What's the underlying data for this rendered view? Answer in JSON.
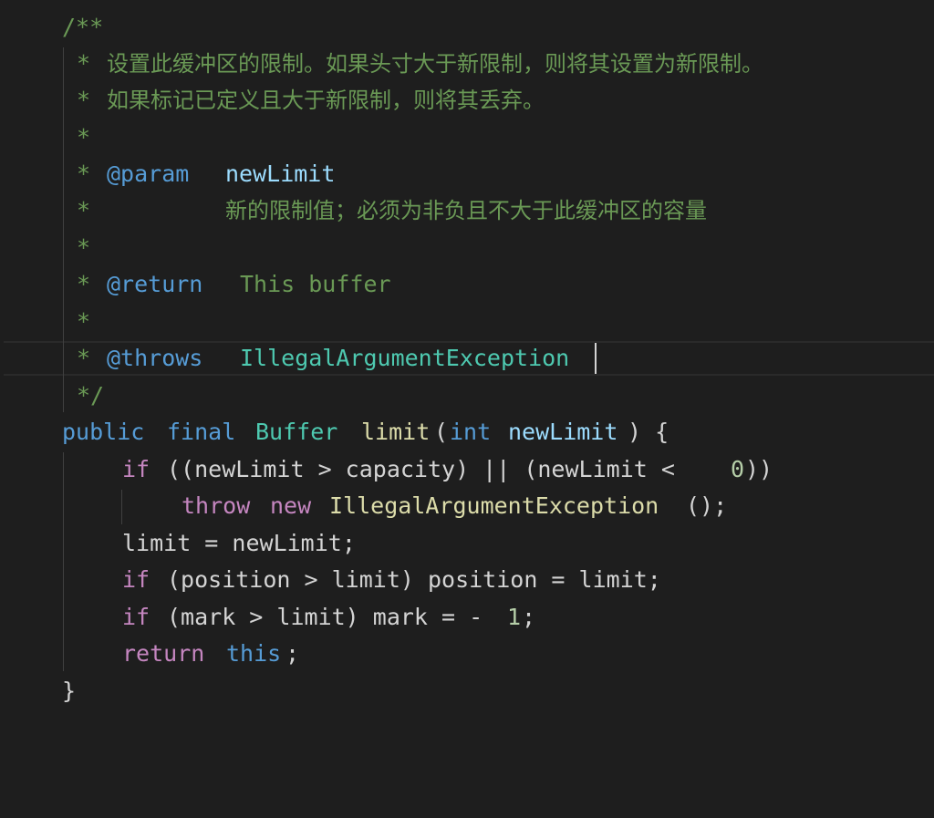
{
  "colors": {
    "background": "#1e1e1e",
    "comment": "#6a9955",
    "doc_tag": "#569cd6",
    "param_name": "#9cdcfe",
    "type": "#4ec9b0",
    "keyword": "#569cd6",
    "control_keyword": "#c586c0",
    "function": "#dcdcaa",
    "number": "#b5cea8",
    "plain": "#d4d4d4"
  },
  "code": {
    "javadoc": {
      "open": "/**",
      "star": "*",
      "close": "*/",
      "desc_line_1": "设置此缓冲区的限制。如果头寸大于新限制，则将其设置为新限制。",
      "desc_line_2": "如果标记已定义且大于新限制，则将其丢弃。",
      "param_tag": "@param",
      "param_name": "newLimit",
      "param_desc": "新的限制值；必须为非负且不大于此缓冲区的容量",
      "return_tag": "@return",
      "return_desc": "This buffer",
      "throws_tag": "@throws",
      "throws_type": "IllegalArgumentException"
    },
    "signature": {
      "kw_public": "public",
      "kw_final": "final",
      "return_type": "Buffer",
      "method_name": "limit",
      "open_paren": "(",
      "param_type": "int",
      "param_name": "newLimit",
      "close_brace_open": ") {"
    },
    "if1": {
      "kw_if": "if",
      "cond_part_1": "((newLimit > capacity) || (newLimit < ",
      "zero": "0",
      "cond_part_2": "))"
    },
    "throw_stmt": {
      "kw_throw": "throw",
      "kw_new": "new",
      "exception_class": "IllegalArgumentException",
      "tail": "();"
    },
    "assign_stmt": "limit = newLimit;",
    "if2": {
      "kw_if": "if",
      "body": "(position > limit) position = limit;"
    },
    "if3": {
      "kw_if": "if",
      "body_part_1": "(mark > limit) mark = -",
      "one": "1",
      "semicolon": ";"
    },
    "return_stmt": {
      "kw_return": "return",
      "kw_this": "this",
      "semicolon": ";"
    },
    "closing_brace": "}"
  }
}
